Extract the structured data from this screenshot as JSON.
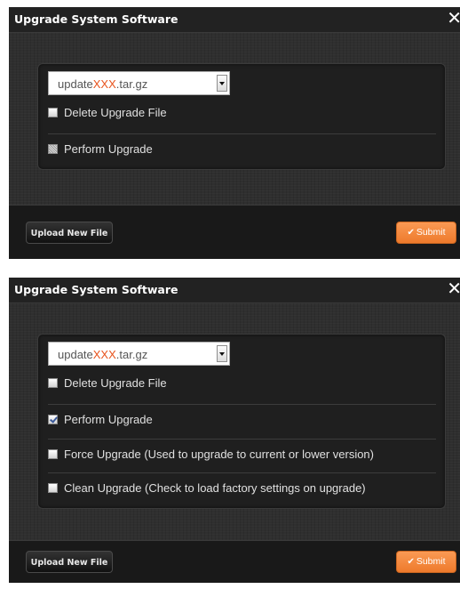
{
  "dialogs": [
    {
      "title": "Upgrade System Software",
      "close_icon": "close-icon",
      "file_select": {
        "prefix": "update",
        "highlight": "XXX",
        "suffix": ".tar.gz",
        "highlight_color": "#e8541e"
      },
      "options": [
        {
          "label": "Delete Upgrade File",
          "checked": false
        },
        {
          "label": "Perform Upgrade",
          "checked": false,
          "focused": true
        }
      ],
      "upload_label": "Upload New File",
      "submit_label": "Submit",
      "submit_icon": "check-icon"
    },
    {
      "title": "Upgrade System Software",
      "close_icon": "close-icon",
      "file_select": {
        "prefix": "update",
        "highlight": "XXX",
        "suffix": ".tar.gz",
        "highlight_color": "#e8541e"
      },
      "options": [
        {
          "label": "Delete Upgrade File",
          "checked": false
        },
        {
          "label": "Perform Upgrade",
          "checked": true
        },
        {
          "label": "Force Upgrade (Used to upgrade to current or lower version)",
          "checked": false
        },
        {
          "label": "Clean Upgrade (Check to load factory settings on upgrade)",
          "checked": false
        }
      ],
      "upload_label": "Upload New File",
      "submit_label": "Submit",
      "submit_icon": "check-icon"
    }
  ],
  "colors": {
    "accent_orange": "#f28a3c",
    "dialog_bg": "#2b2b2b",
    "footer_bg": "#191919",
    "panel_bg": "#1f1f1f"
  }
}
